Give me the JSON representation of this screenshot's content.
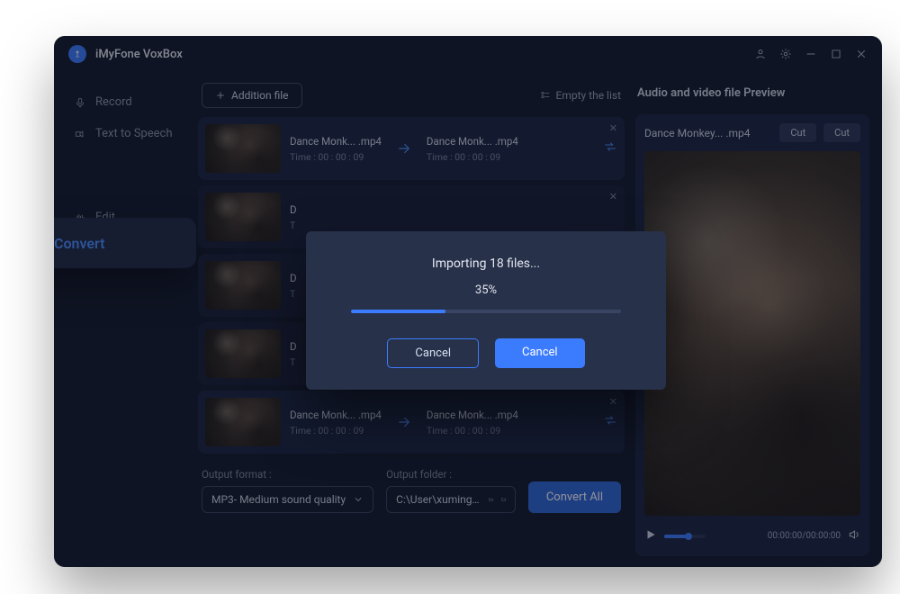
{
  "app_title": "iMyFone VoxBox",
  "sidebar": {
    "record": "Record",
    "tts": "Text to Speech",
    "convert": "Convert",
    "edit": "Edit"
  },
  "toolbar": {
    "addition_file": "Addition file",
    "empty_list": "Empty the list"
  },
  "items": [
    {
      "name_a": "Dance Monk... .mp4",
      "time_a": "Time : 00 : 00 : 09",
      "name_b": "Dance Monk... .mp4",
      "time_b": "Time : 00 : 00 : 09"
    },
    {
      "name_a": "D",
      "time_a": "T"
    },
    {
      "name_a": "D",
      "time_a": "T"
    },
    {
      "name_a": "D",
      "time_a": "T"
    },
    {
      "name_a": "Dance Monk... .mp4",
      "time_a": "Time : 00 : 00 : 09",
      "name_b": "Dance Monk... .mp4",
      "time_b": "Time : 00 : 00 : 09"
    }
  ],
  "output": {
    "format_label": "Output format :",
    "format_value": "MP3- Medium sound quality",
    "folder_label": "Output folder :",
    "folder_value": "C:\\User\\xumingyi\\Desktop\\Musicccccccccccc...",
    "convert_all": "Convert All"
  },
  "preview": {
    "header": "Audio and video file Preview",
    "filename": "Dance Monkey... .mp4",
    "cut": "Cut",
    "timecode": "00:00:00/00:00:00"
  },
  "modal": {
    "title": "Importing 18 files...",
    "percent_value": 35,
    "percent_text": "35%",
    "cancel": "Cancel"
  }
}
